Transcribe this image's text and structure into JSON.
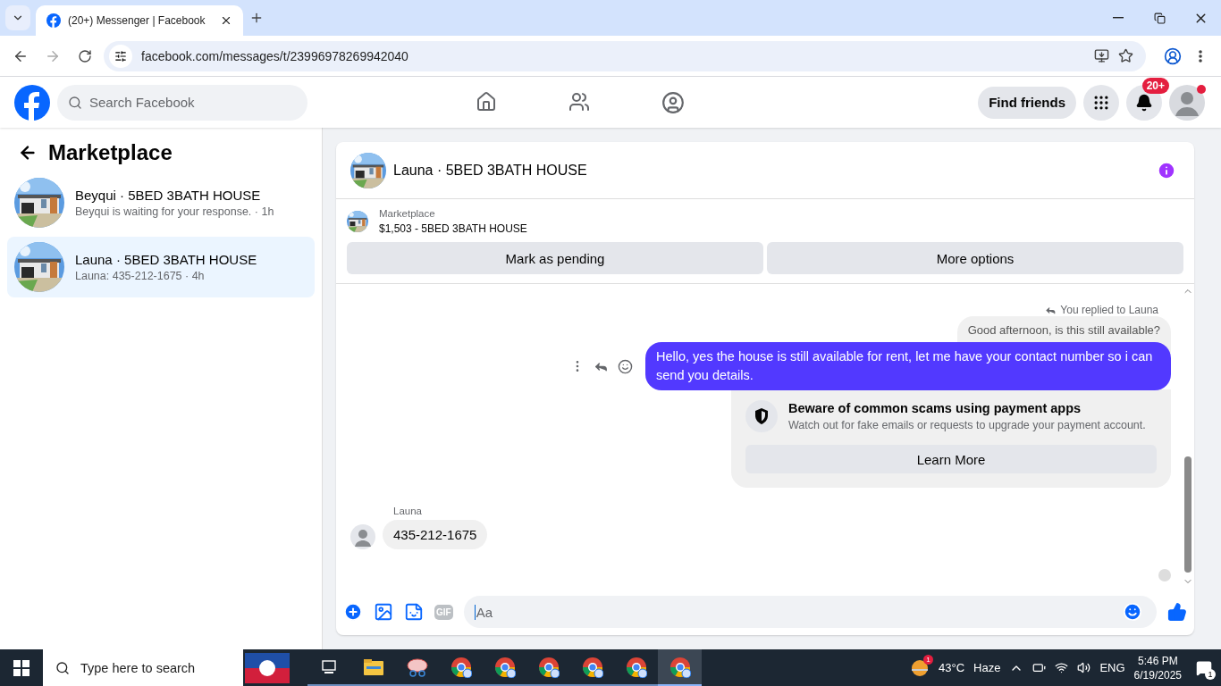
{
  "browser": {
    "tab_title": "(20+) Messenger | Facebook",
    "url": "facebook.com/messages/t/23996978269942040"
  },
  "header": {
    "search_placeholder": "Search Facebook",
    "find_friends": "Find friends",
    "notification_badge": "20+"
  },
  "sidebar": {
    "title": "Marketplace",
    "conversations": [
      {
        "name": "Beyqui · 5BED 3BATH HOUSE",
        "preview": "Beyqui is waiting for your response. · 1h",
        "selected": false
      },
      {
        "name": "Launa · 5BED 3BATH HOUSE",
        "preview": "Launa: 435-212-1675 · 4h",
        "selected": true
      }
    ]
  },
  "chat": {
    "title": "Launa · 5BED 3BATH HOUSE",
    "listing": {
      "label": "Marketplace",
      "summary": "$1,503 - 5BED 3BATH HOUSE"
    },
    "actions": [
      "Mark as pending",
      "More options"
    ],
    "reply_note": "You replied to Launa",
    "quoted": "Good afternoon, is this still available?",
    "sent": "Hello, yes the house is still available for rent, let me have your contact number so i can send you details.",
    "warning": {
      "title": "Beware of common scams using payment apps",
      "body": "Watch out for fake emails or requests to upgrade your payment account.",
      "button": "Learn More"
    },
    "incoming": {
      "sender": "Launa",
      "text": "435-212-1675"
    },
    "composer": {
      "gif": "GIF",
      "placeholder": "Aa"
    }
  },
  "taskbar": {
    "search_placeholder": "Type here to search",
    "apps": [
      {
        "kind": "taskview",
        "selected": false
      },
      {
        "kind": "folder",
        "selected": false
      },
      {
        "kind": "snip",
        "selected": false
      },
      {
        "kind": "browser",
        "selected": false
      },
      {
        "kind": "browser",
        "selected": false
      },
      {
        "kind": "browser",
        "selected": false
      },
      {
        "kind": "browser",
        "selected": false
      },
      {
        "kind": "browser",
        "selected": false
      },
      {
        "kind": "browser",
        "selected": true
      }
    ],
    "weather_badge": "1",
    "temperature": "43°C",
    "condition": "Haze",
    "language": "ENG",
    "time": "5:46 PM",
    "date": "6/19/2025",
    "notifications": "1"
  }
}
